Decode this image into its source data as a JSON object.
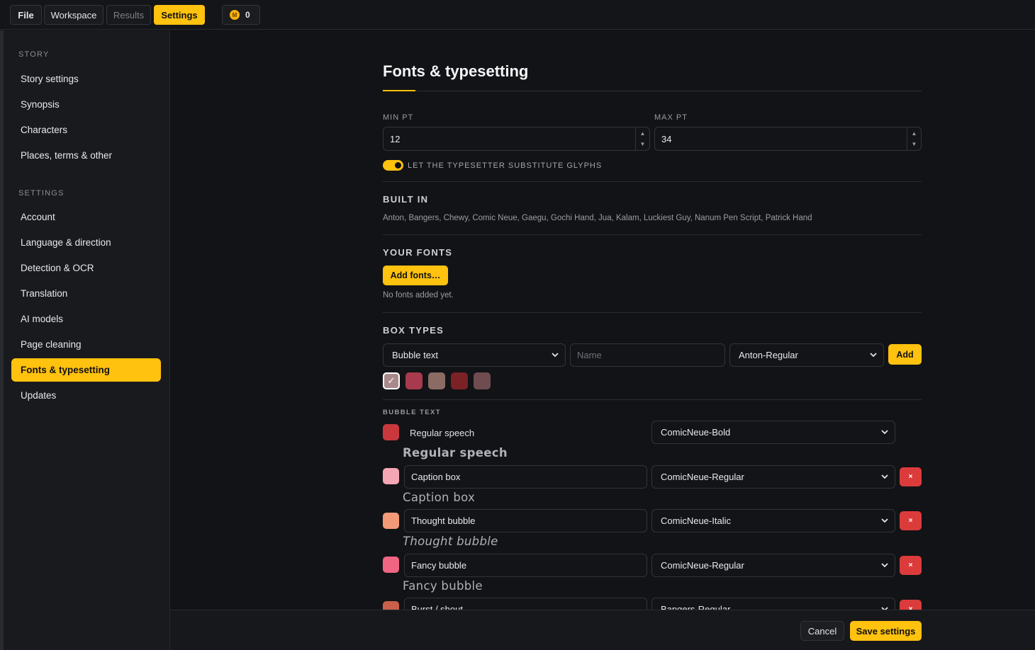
{
  "topbar": {
    "tabs": [
      {
        "label": "File"
      },
      {
        "label": "Workspace"
      },
      {
        "label": "Results"
      },
      {
        "label": "Settings"
      }
    ],
    "credits": {
      "icon": "M",
      "value": "0"
    }
  },
  "sidebar": {
    "story_heading": "STORY",
    "story_items": [
      {
        "label": "Story settings"
      },
      {
        "label": "Synopsis"
      },
      {
        "label": "Characters"
      },
      {
        "label": "Places, terms & other"
      }
    ],
    "settings_heading": "SETTINGS",
    "settings_items": [
      {
        "label": "Account"
      },
      {
        "label": "Language & direction"
      },
      {
        "label": "Detection & OCR"
      },
      {
        "label": "Translation"
      },
      {
        "label": "AI models"
      },
      {
        "label": "Page cleaning"
      },
      {
        "label": "Fonts & typesetting"
      },
      {
        "label": "Updates"
      }
    ]
  },
  "page": {
    "title": "Fonts & typesetting",
    "min_pt_label": "MIN PT",
    "min_pt_value": "12",
    "max_pt_label": "MAX PT",
    "max_pt_value": "34",
    "toggle_label": "LET THE TYPESETTER SUBSTITUTE GLYPHS",
    "toggle_on": true,
    "built_in_heading": "BUILT IN",
    "built_in_fonts": "Anton, Bangers, Chewy, Comic Neue, Gaegu, Gochi Hand, Jua, Kalam, Luckiest Guy, Nanum Pen Script, Patrick Hand",
    "your_fonts_heading": "YOUR FONTS",
    "add_fonts_label": "Add fonts…",
    "no_fonts_text": "No fonts added yet.",
    "box_types_heading": "BOX TYPES",
    "box_type_select": "Bubble text",
    "name_placeholder": "Name",
    "font_select": "Anton-Regular",
    "add_label": "Add",
    "colors": [
      "#a98a8c",
      "#a83a4e",
      "#8a6c64",
      "#7a2226",
      "#6e4c50"
    ],
    "group_heading": "BUBBLE TEXT",
    "rows": [
      {
        "name": "Regular speech",
        "font": "ComicNeue-Bold",
        "preview": "Regular speech",
        "color": "#c9383d"
      },
      {
        "name": "Caption box",
        "font": "ComicNeue-Regular",
        "preview": "Caption box",
        "color": "#f5a6b4",
        "remove": "×"
      },
      {
        "name": "Thought bubble",
        "font": "ComicNeue-Italic",
        "preview": "Thought bubble",
        "color": "#f39a79",
        "remove": "×"
      },
      {
        "name": "Fancy bubble",
        "font": "ComicNeue-Regular",
        "preview": "Fancy bubble",
        "color": "#f06581",
        "remove": "×"
      },
      {
        "name": "Burst / shout",
        "font": "Bangers-Regular",
        "color": "#c9614a",
        "remove": "×"
      }
    ]
  },
  "footer": {
    "cancel_label": "Cancel",
    "save_label": "Save settings"
  }
}
